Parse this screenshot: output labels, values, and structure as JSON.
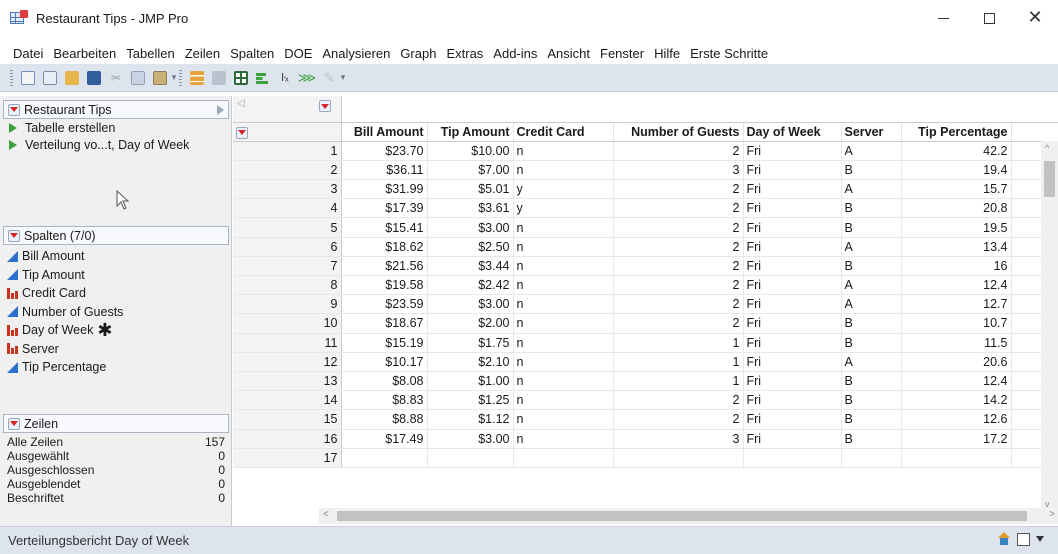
{
  "window": {
    "title": "Restaurant Tips - JMP Pro"
  },
  "menu": [
    "Datei",
    "Bearbeiten",
    "Tabellen",
    "Zeilen",
    "Spalten",
    "DOE",
    "Analysieren",
    "Graph",
    "Extras",
    "Add-ins",
    "Ansicht",
    "Fenster",
    "Hilfe",
    "Erste Schritte"
  ],
  "tables_panel": {
    "title": "Restaurant Tips",
    "scripts": [
      "Tabelle erstellen",
      "Verteilung vo...t, Day of Week"
    ]
  },
  "columns_panel": {
    "title": "Spalten (7/0)",
    "columns": [
      {
        "name": "Bill Amount",
        "type": "continuous",
        "marked": false
      },
      {
        "name": "Tip Amount",
        "type": "continuous",
        "marked": false
      },
      {
        "name": "Credit Card",
        "type": "nominal",
        "marked": false
      },
      {
        "name": "Number of Guests",
        "type": "continuous",
        "marked": false
      },
      {
        "name": "Day of Week",
        "type": "nominal",
        "marked": true
      },
      {
        "name": "Server",
        "type": "nominal",
        "marked": false
      },
      {
        "name": "Tip Percentage",
        "type": "continuous",
        "marked": false
      }
    ],
    "marker": "✱"
  },
  "rows_panel": {
    "title": "Zeilen",
    "stats": [
      {
        "label": "Alle Zeilen",
        "value": "157"
      },
      {
        "label": "Ausgewählt",
        "value": "0"
      },
      {
        "label": "Ausgeschlossen",
        "value": "0"
      },
      {
        "label": "Ausgeblendet",
        "value": "0"
      },
      {
        "label": "Beschriftet",
        "value": "0"
      }
    ]
  },
  "grid": {
    "headers": [
      "Bill Amount",
      "Tip Amount",
      "Credit Card",
      "Number of Guests",
      "Day of Week",
      "Server",
      "Tip Percentage"
    ],
    "rows": [
      [
        "1",
        "$23.70",
        "$10.00",
        "n",
        "2",
        "Fri",
        "A",
        "42.2"
      ],
      [
        "2",
        "$36.11",
        "$7.00",
        "n",
        "3",
        "Fri",
        "B",
        "19.4"
      ],
      [
        "3",
        "$31.99",
        "$5.01",
        "y",
        "2",
        "Fri",
        "A",
        "15.7"
      ],
      [
        "4",
        "$17.39",
        "$3.61",
        "y",
        "2",
        "Fri",
        "B",
        "20.8"
      ],
      [
        "5",
        "$15.41",
        "$3.00",
        "n",
        "2",
        "Fri",
        "B",
        "19.5"
      ],
      [
        "6",
        "$18.62",
        "$2.50",
        "n",
        "2",
        "Fri",
        "A",
        "13.4"
      ],
      [
        "7",
        "$21.56",
        "$3.44",
        "n",
        "2",
        "Fri",
        "B",
        "16"
      ],
      [
        "8",
        "$19.58",
        "$2.42",
        "n",
        "2",
        "Fri",
        "A",
        "12.4"
      ],
      [
        "9",
        "$23.59",
        "$3.00",
        "n",
        "2",
        "Fri",
        "A",
        "12.7"
      ],
      [
        "10",
        "$18.67",
        "$2.00",
        "n",
        "2",
        "Fri",
        "B",
        "10.7"
      ],
      [
        "11",
        "$15.19",
        "$1.75",
        "n",
        "1",
        "Fri",
        "B",
        "11.5"
      ],
      [
        "12",
        "$10.17",
        "$2.10",
        "n",
        "1",
        "Fri",
        "A",
        "20.6"
      ],
      [
        "13",
        "$8.08",
        "$1.00",
        "n",
        "1",
        "Fri",
        "B",
        "12.4"
      ],
      [
        "14",
        "$8.83",
        "$1.25",
        "n",
        "2",
        "Fri",
        "B",
        "14.2"
      ],
      [
        "15",
        "$8.88",
        "$1.12",
        "n",
        "2",
        "Fri",
        "B",
        "12.6"
      ],
      [
        "16",
        "$17.49",
        "$3.00",
        "n",
        "3",
        "Fri",
        "B",
        "17.2"
      ],
      [
        "17",
        "",
        "",
        "",
        "",
        "",
        "",
        ""
      ]
    ]
  },
  "status": {
    "text": "Verteilungsbericht Day of Week"
  }
}
